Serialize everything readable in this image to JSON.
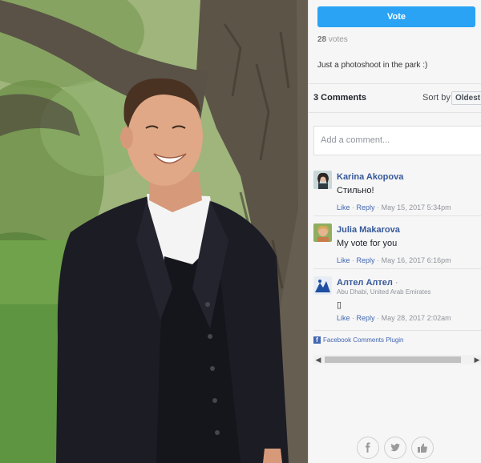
{
  "vote": {
    "button_label": "Vote",
    "count": "28",
    "count_suffix": "votes"
  },
  "description": "Just a photoshoot in the park :)",
  "comments": {
    "header": "3 Comments",
    "sort_label": "Sort by",
    "sort_value": "Oldest",
    "placeholder": "Add a comment...",
    "items": [
      {
        "author": "Karina Akopova",
        "text": "Стильно!",
        "like": "Like",
        "reply": "Reply",
        "timestamp": "May 15, 2017 5:34pm"
      },
      {
        "author": "Julia Makarova",
        "text": "My vote for you",
        "like": "Like",
        "reply": "Reply",
        "timestamp": "May 16, 2017 6:16pm"
      },
      {
        "author": "Алтел Алтел",
        "subtitle": "Abu Dhabi, United Arab Emirates",
        "text": "▯",
        "like": "Like",
        "reply": "Reply",
        "timestamp": "May 28, 2017 2:02am"
      }
    ],
    "plugin_label": "Facebook Comments Plugin"
  },
  "share": {
    "icons": [
      "facebook-icon",
      "twitter-icon",
      "thumbs-up-icon"
    ]
  },
  "colors": {
    "vote_blue": "#2aa3f5",
    "fb_link": "#365899",
    "fb_blue": "#4267b2"
  }
}
